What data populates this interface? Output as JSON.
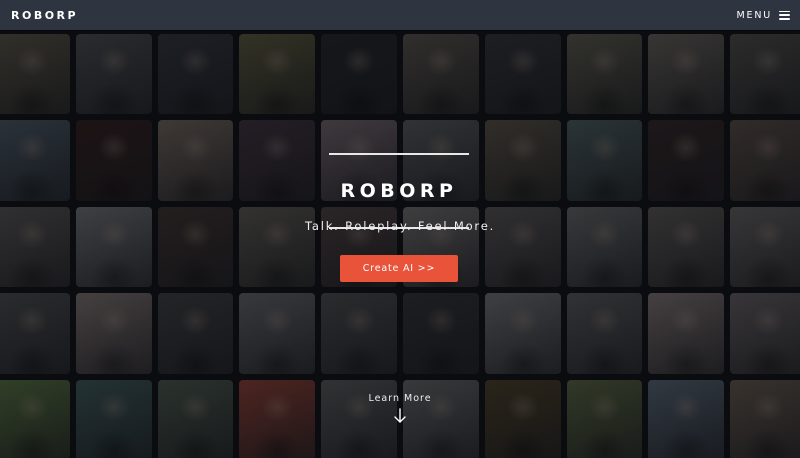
{
  "header": {
    "brand": "ROBORP",
    "menu_label": "MENU",
    "menu_icon": "hamburger-icon"
  },
  "hero": {
    "title": "ROBORP",
    "tagline": "Talk. Roleplay. Feel More.",
    "cta_label": "Create AI >>",
    "learn_more_label": "Learn More",
    "learn_more_icon": "arrow-down-icon"
  },
  "colors": {
    "topbar": "#2e3540",
    "cta": "#e8533a",
    "overlay": "rgba(8,10,14,0.58)"
  },
  "gallery": {
    "columns": 10,
    "rows": 5,
    "tile_colors": [
      "#6b6450",
      "#5a5a5c",
      "#3a3d48",
      "#6e6a46",
      "#2a2a2e",
      "#6a6258",
      "#3b3a40",
      "#6e6a5a",
      "#7a726a",
      "#5d5a55",
      "#5a6a78",
      "#3a2020",
      "#8a7a6e",
      "#4a3a46",
      "#8a7a80",
      "#6a6a6a",
      "#6a6050",
      "#5a6e70",
      "#3a2a2a",
      "#6a5a50",
      "#6a6462",
      "#8a8a8e",
      "#4a3a36",
      "#6e6a60",
      "#5a4a4a",
      "#8a8482",
      "#6a6462",
      "#7a7a7a",
      "#6e6864",
      "#7a7472",
      "#5a5a5a",
      "#9a8a86",
      "#4a4a4a",
      "#7a7a7e",
      "#5a5a5a",
      "#3a3a3a",
      "#8a8a8a",
      "#6a6a6a",
      "#9a8a88",
      "#7a7272",
      "#6a8a4a",
      "#4a6a6a",
      "#5a6a5a",
      "#aa4a3a",
      "#6a6a6a",
      "#7a7a7a",
      "#5a4a2a",
      "#6a7a4a",
      "#6a7a8a",
      "#7a6a5a"
    ]
  }
}
